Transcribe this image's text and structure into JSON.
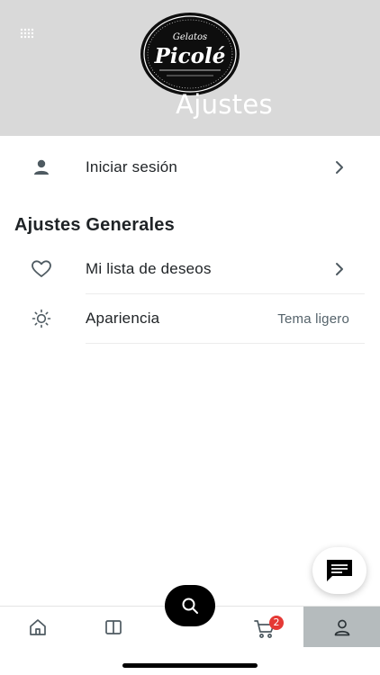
{
  "header": {
    "title": "Ajustes",
    "logo_text": "Picolé",
    "logo_subtext": "Gelatos"
  },
  "account": {
    "login_label": "Iniciar sesión"
  },
  "general": {
    "section_title": "Ajustes Generales",
    "items": [
      {
        "label": "Mi lista de deseos",
        "icon": "heart-icon"
      },
      {
        "label": "Apariencia",
        "icon": "sun-icon",
        "value": "Tema ligero"
      }
    ]
  },
  "tabbar": {
    "tabs": [
      {
        "icon": "home-icon"
      },
      {
        "icon": "catalog-icon"
      },
      {
        "icon": "search-icon"
      },
      {
        "icon": "cart-icon",
        "badge": "2"
      },
      {
        "icon": "profile-icon",
        "active": true
      }
    ]
  },
  "colors": {
    "header_bg": "#d9d9d9",
    "active_tab": "#b5bbbd",
    "badge": "#e53935",
    "icon": "#4e5a61"
  }
}
